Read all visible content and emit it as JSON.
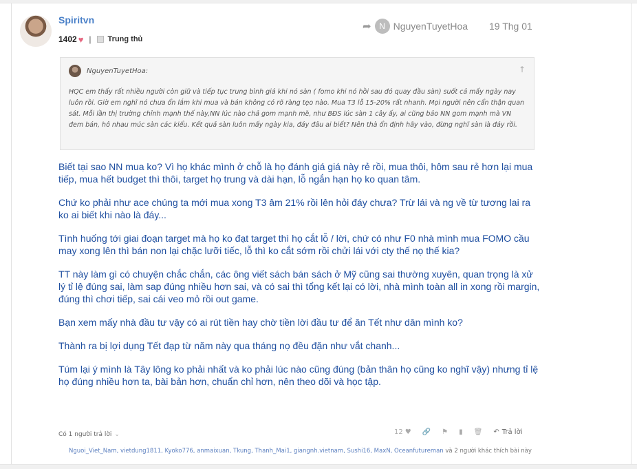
{
  "post": {
    "author": "Spiritvn",
    "reputation": "1402",
    "heart_icon": "heart-icon",
    "rank": "Trung thủ",
    "shared_by": "NguyenTuyetHoa",
    "shared_by_initial": "N",
    "date": "19 Thg 01"
  },
  "quote": {
    "author": "NguyenTuyetHoa:",
    "text": "HQC em thấy rất nhiều người còn giữ và tiếp tục trung bình giá khi nó sàn ( fomo khi nó hồi sau đó quay đầu sàn) suốt cả mấy ngày nay luôn rồi. Giờ em nghĩ nó chưa ổn lắm khi mua và bán không có rõ ràng tẹo nào. Mua T3 lỗ 15-20% rất nhanh. Mọi người nên cẩn thận quan sát. Mỗi lần thị trường chỉnh mạnh thế này,NN lúc nào chả gom mạnh mẽ, như BĐS lúc sàn 1 cây ấy, ai cũng bảo NN gom mạnh mà VN đem bán, hô nhau múc sàn các kiểu. Kết quả sàn luôn mấy ngày kia, đáy đâu ai biết? Nên thà ổn định hãy vào, đừng nghĩ sàn là đáy rồi."
  },
  "body": {
    "paragraphs": [
      "Biết tại sao NN mua ko? Vì họ khác mình ở chỗ là họ đánh giá giá này rẻ rồi, mua thôi, hôm sau rẻ hơn lại mua tiếp, mua hết budget thì thôi, target họ trung và dài hạn, lỗ ngắn hạn họ ko quan tâm.",
      "Chứ ko phải như ace chúng ta mới mua xong T3 âm 21% rồi lên hỏi đáy chưa? Trừ lái và ng về từ tương lai ra ko ai biết khi nào là đáy...",
      "Tình huống tới giai đoạn target mà họ ko đạt target thì họ cắt lỗ / lời, chứ có như F0 nhà mình mua FOMO cầu may xong lên thì bán non lại chặc lưỡi tiếc, lỗ thì ko cắt sớm rồi chửi lái với cty thế nọ thế kia?",
      "TT này làm gì có chuyện chắc chắn, các ông viết sách bán sách ở Mỹ cũng sai thường xuyên, quan trọng là xử lý tỉ lệ đúng sai, làm sap đúng nhiều hơn sai, và có sai thì tổng kết lại có lời, nhà mình toàn all in xong rồi margin, đúng thì chơi tiếp, sai cái veo mỏ rồi out game.",
      "Bạn xem mấy nhà đầu tư vậy có ai rút tiền hay chờ tiền lời đầu tư để ăn Tết như dân mình ko?",
      "Thành ra bị lợi dụng Tết đạp từ năm này qua tháng nọ đều đặn như vắt chanh...",
      "Túm lại ý mình là Tây lông ko phải nhất và ko phải lúc nào cũng đúng (bản thân họ cũng ko nghĩ vậy) nhưng tỉ lệ họ đúng nhiều hơn ta, bài bản hơn, chuẩn chỉ hơn, nên theo dõi và học tập."
    ]
  },
  "footer": {
    "reply_count": "Có 1 người trả lời",
    "likes": "12",
    "reply_label": "Trả lời",
    "likers": "Nguoi_Viet_Nam, vietdung1811, Kyoko776, anmaixuan, Tkung, Thanh_Mai1, giangnh.vietnam, Sushi16, MaxN, Oceanfutureman",
    "likers_suffix": " và 2 người khác thích bài này"
  }
}
